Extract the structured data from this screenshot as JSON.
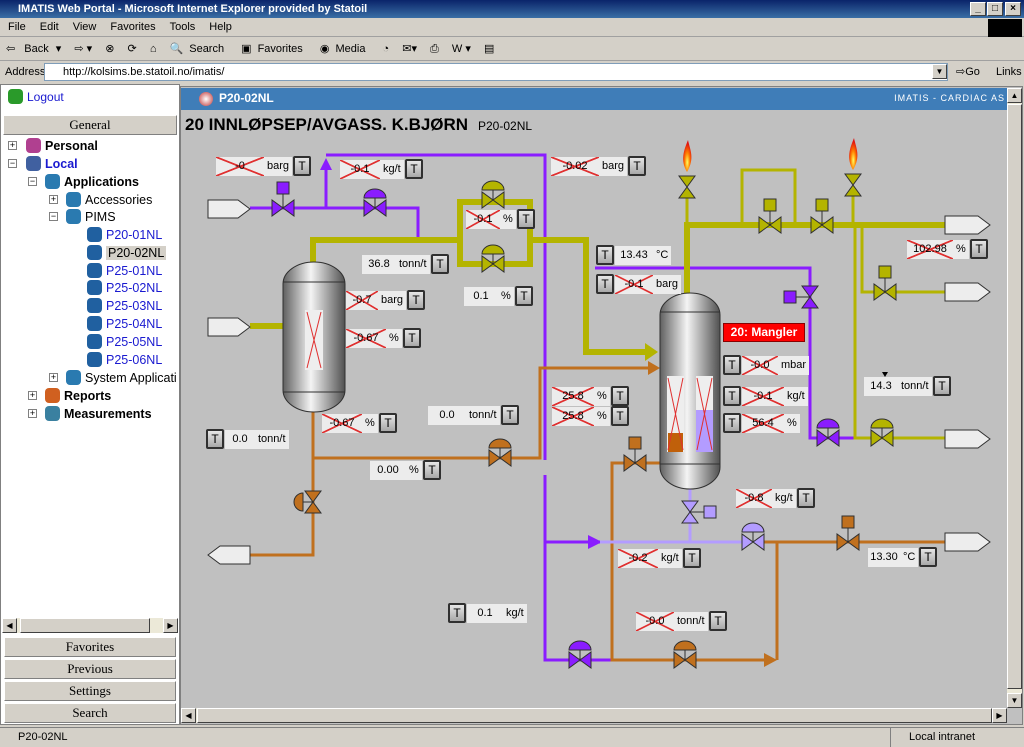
{
  "window": {
    "title": "IMATIS Web Portal - Microsoft Internet Explorer provided by Statoil"
  },
  "menu": [
    "File",
    "Edit",
    "View",
    "Favorites",
    "Tools",
    "Help"
  ],
  "toolbar": {
    "back": "Back",
    "search": "Search",
    "favorites": "Favorites",
    "media": "Media"
  },
  "address": {
    "label": "Address",
    "url": "http://kolsims.be.statoil.no/imatis/",
    "go": "Go",
    "links": "Links"
  },
  "sidebar": {
    "logout": "Logout",
    "general": "General",
    "tree": {
      "personal": "Personal",
      "local": "Local",
      "applications": "Applications",
      "accessories": "Accessories",
      "pims": "PIMS",
      "pims_items": [
        "P20-01NL",
        "P20-02NL",
        "P25-01NL",
        "P25-02NL",
        "P25-03NL",
        "P25-04NL",
        "P25-05NL",
        "P25-06NL"
      ],
      "selected": "P20-02NL",
      "system": "System Applicati",
      "reports": "Reports",
      "measurements": "Measurements"
    },
    "buttons": [
      "Favorites",
      "Previous",
      "Settings",
      "Search"
    ]
  },
  "panel": {
    "tab": "P20-02NL",
    "brand": "IMATIS - CARDIAC AS",
    "title": "20 INNLØPSEP/AVGASS. K.BJØRN",
    "subtitle": "P20-02NL",
    "alarm": "20: Mangler",
    "button_label": "T"
  },
  "colors": {
    "gas": "#8a1cff",
    "oil": "#b4b400",
    "water": "#c0701e",
    "light": "#b39cff",
    "alarm": "#ff0000",
    "header": "#3f7db8"
  },
  "tags": [
    {
      "value": "-0",
      "unit": "barg",
      "crossed": true
    },
    {
      "value": "-0.1",
      "unit": "kg/t",
      "crossed": true
    },
    {
      "value": "-0.02",
      "unit": "barg",
      "crossed": true
    },
    {
      "value": "-0.1",
      "unit": "%",
      "crossed": true
    },
    {
      "value": "36.8",
      "unit": "tonn/t",
      "crossed": false
    },
    {
      "value": "0.1",
      "unit": "%",
      "crossed": false
    },
    {
      "value": "13.43",
      "unit": "°C",
      "crossed": false
    },
    {
      "value": "-0.1",
      "unit": "barg",
      "crossed": true
    },
    {
      "value": "102.98",
      "unit": "%",
      "crossed": true
    },
    {
      "value": "-0.7",
      "unit": "barg",
      "crossed": true
    },
    {
      "value": "-0.67",
      "unit": "%",
      "crossed": true
    },
    {
      "value": "-0.0",
      "unit": "mbar",
      "crossed": true
    },
    {
      "value": "14.3",
      "unit": "tonn/t",
      "crossed": false
    },
    {
      "value": "25.8",
      "unit": "%",
      "crossed": true
    },
    {
      "value": "25.8",
      "unit": "%",
      "crossed": true
    },
    {
      "value": "-0.1",
      "unit": "kg/t",
      "crossed": true
    },
    {
      "value": "56.4",
      "unit": "%",
      "crossed": true
    },
    {
      "value": "0.0",
      "unit": "tonn/t",
      "crossed": false
    },
    {
      "value": "-0.67",
      "unit": "%",
      "crossed": true
    },
    {
      "value": "0.0",
      "unit": "tonn/t",
      "crossed": false
    },
    {
      "value": "0.00",
      "unit": "%",
      "crossed": false
    },
    {
      "value": "-0.8",
      "unit": "kg/t",
      "crossed": true
    },
    {
      "value": "-0.2",
      "unit": "kg/t",
      "crossed": true
    },
    {
      "value": "13.30",
      "unit": "°C",
      "crossed": false
    },
    {
      "value": "0.1",
      "unit": "kg/t",
      "crossed": false
    },
    {
      "value": "-0.0",
      "unit": "tonn/t",
      "crossed": true
    }
  ],
  "status": {
    "text": "P20-02NL",
    "zone": "Local intranet"
  }
}
